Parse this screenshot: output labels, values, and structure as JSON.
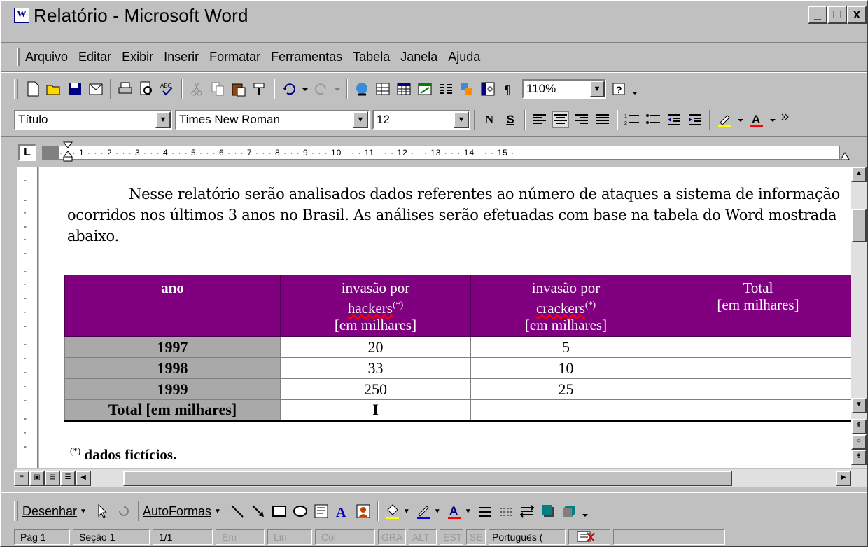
{
  "window": {
    "title": "Relatório - Microsoft Word",
    "minimize": "_",
    "maximize": "□",
    "close": "x"
  },
  "menu": [
    "Arquivo",
    "Editar",
    "Exibir",
    "Inserir",
    "Formatar",
    "Ferramentas",
    "Tabela",
    "Janela",
    "Ajuda"
  ],
  "standard_toolbar": {
    "zoom": "110%"
  },
  "format_toolbar": {
    "style": "Título",
    "font": "Times New Roman",
    "size": "12",
    "bold": "N",
    "underline": "S"
  },
  "ruler": {
    "tab_marker": "L",
    "marks": "· · · 1 · · · 2 · · · 3 · · · 4 · · · 5 · · · 6 · · · 7 · · · 8 · · · 9 · · · 10 · · · 11 · · · 12 · · · 13 · · · 14 · · · 15 ·"
  },
  "document": {
    "paragraph": "Nesse relatório serão analisados dados referentes ao número de ataques a sistema de informação ocorridos nos últimos 3 anos no Brasil. As análises serão efetuadas com base na tabela do Word mostrada abaixo.",
    "table": {
      "headers": [
        {
          "line1": "ano"
        },
        {
          "line1": "invasão por",
          "line2": "hackers",
          "sup": "(*)",
          "line3": "[em milhares]"
        },
        {
          "line1": "invasão por",
          "line2": "crackers",
          "sup": "(*)",
          "line3": "[em milhares]"
        },
        {
          "line1": "Total",
          "line2": "[em milhares]"
        }
      ],
      "rows": [
        {
          "year": "1997",
          "hackers": "20",
          "crackers": "5",
          "total": ""
        },
        {
          "year": "1998",
          "hackers": "33",
          "crackers": "10",
          "total": ""
        },
        {
          "year": "1999",
          "hackers": "250",
          "crackers": "25",
          "total": ""
        },
        {
          "year": "Total [em milhares]",
          "hackers": "I",
          "crackers": "",
          "total": ""
        }
      ]
    },
    "note_sup": "(*)",
    "note": "dados fictícios."
  },
  "drawing_toolbar": {
    "draw": "Desenhar",
    "autoshapes": "AutoFormas"
  },
  "status_bar": {
    "page": "Pág 1",
    "section": "Seção 1",
    "pages": "1/1",
    "at": "Em",
    "line": "Lin",
    "col": "Col",
    "rec": "GRA",
    "trk": "ALT",
    "ext": "EST",
    "ovr": "SE",
    "language": "Português ("
  }
}
